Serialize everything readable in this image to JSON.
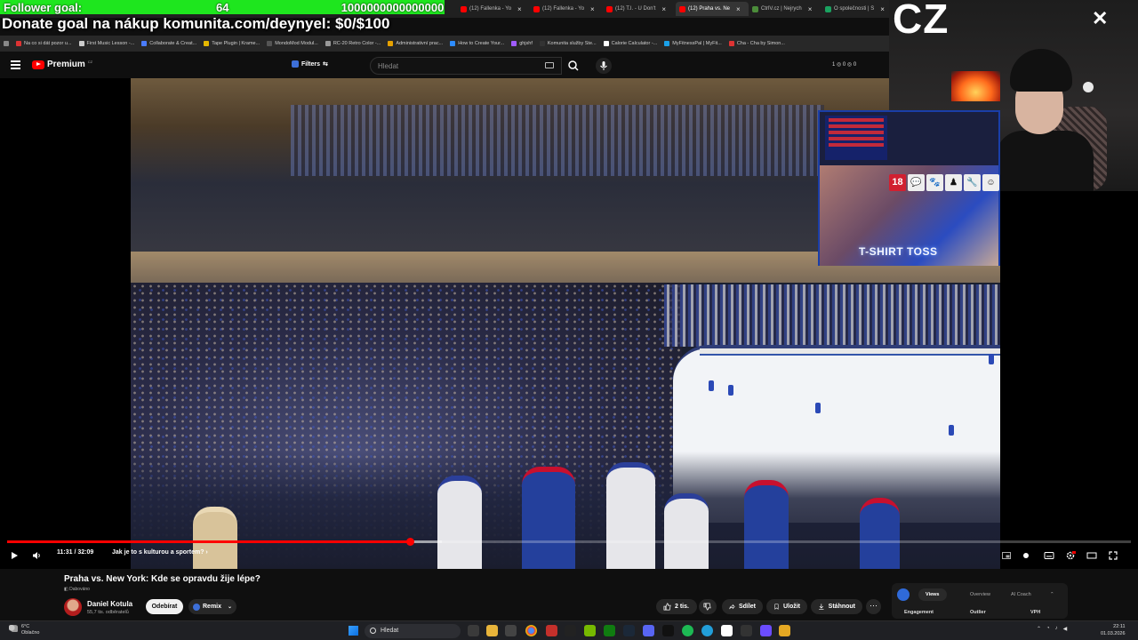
{
  "overlay": {
    "goal_label": "Follower goal:",
    "goal_current": "64",
    "goal_target": "1000000000000000",
    "donate_text": "Donate goal na nákup komunita.com/deynyel: $0/$100"
  },
  "browser": {
    "tabs": [
      {
        "label": "(12) Fallenka - Yo",
        "color": "#ff0000",
        "active": false
      },
      {
        "label": "(12) Fallenka - Yo",
        "color": "#ff0000",
        "active": false
      },
      {
        "label": "(12) T.I. - U Don't",
        "color": "#ff0000",
        "active": false
      },
      {
        "label": "(12) Praha vs. Ne",
        "color": "#ff0000",
        "active": true
      },
      {
        "label": "CtrlV.cz | Nejrych",
        "color": "#4b8c3a",
        "active": false
      },
      {
        "label": "O společnosti | S",
        "color": "#1aa260",
        "active": false
      }
    ],
    "bookmarks": [
      {
        "label": "Na co si dát pozor u...",
        "color": "#d33"
      },
      {
        "label": "First Music Lesson -...",
        "color": "#ccc"
      },
      {
        "label": "Collaborate & Creat...",
        "color": "#4a7cff"
      },
      {
        "label": "Tape Plugin | Krame...",
        "color": "#e6b800"
      },
      {
        "label": "MondoMod Modul...",
        "color": "#555"
      },
      {
        "label": "RC-20 Retro Color -...",
        "color": "#999"
      },
      {
        "label": "Administrativní prac...",
        "color": "#e6a100"
      },
      {
        "label": "How to Create Your...",
        "color": "#2d8cff"
      },
      {
        "label": "ghjshf",
        "color": "#a05cff"
      },
      {
        "label": "Komunita služby Ste...",
        "color": "#333"
      },
      {
        "label": "Calorie Calculator -...",
        "color": "#fff"
      },
      {
        "label": "MyFitnessPal | MyFit...",
        "color": "#1aa0e8"
      },
      {
        "label": "Cha - Cha by Simon...",
        "color": "#d33"
      }
    ]
  },
  "header": {
    "logo_text": "Premium",
    "logo_country": "CZ",
    "filters_label": "Filters",
    "search_placeholder": "Hledat",
    "stats": "1 ◎ 0 ◎ 0"
  },
  "video": {
    "jumbotron_text": "T-SHIRT TOSS",
    "current_time": "11:31 / 32:09",
    "chapter": "Jak je to s kulturou a sportem?",
    "progress_fraction": 0.358,
    "buffered_fraction": 0.387
  },
  "details": {
    "title": "Praha vs. New York: Kde se opravdu žije lépe?",
    "dubbed_label": "Dabováno",
    "channel_name": "Daniel Kotula",
    "subscribers": "55,7 tis. odběratelů",
    "subscribe_label": "Odebírat",
    "remix_label": "Remix",
    "likes": "2 tis.",
    "share_label": "Sdílet",
    "save_label": "Uložit",
    "download_label": "Stáhnout",
    "more_label": "⋯"
  },
  "vidiq": {
    "tabs": [
      "Views",
      "Overview",
      "AI Coach"
    ],
    "metrics": [
      "Engagement",
      "Outlier",
      "VPH"
    ]
  },
  "stream": {
    "cam_text": "CZ",
    "emotes": [
      "18",
      "💬",
      "🐾",
      "♟",
      "🔧",
      "☺"
    ]
  },
  "taskbar": {
    "weather_temp": "6°C",
    "weather_desc": "Oblačno",
    "search_label": "Hledat",
    "time": "22:11",
    "date": "01.03.2026"
  }
}
